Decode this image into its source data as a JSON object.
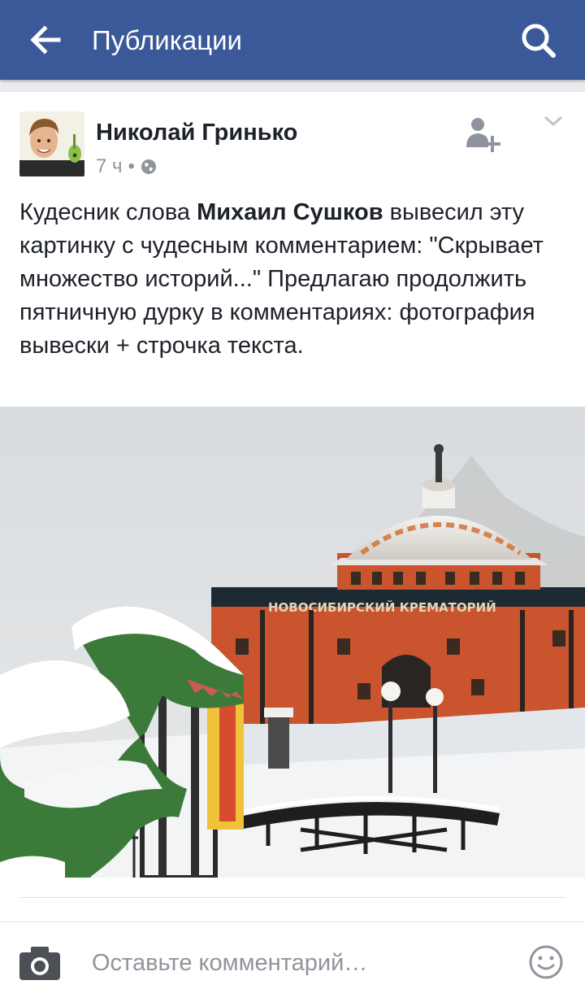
{
  "topbar": {
    "title": "Публикации",
    "back_icon": "arrow-left-icon",
    "search_icon": "search-icon",
    "background_color": "#3b5998"
  },
  "post": {
    "author": "Николай Гринько",
    "time": "7 ч",
    "separator": "•",
    "privacy_icon": "globe-icon",
    "add_friend_icon": "add-friend-icon",
    "menu_icon": "chevron-down-icon",
    "text": {
      "part1": "Кудесник слова ",
      "mention": "Михаил Сушков",
      "part2": " вывесил эту картинку с чудесным комментарием: \"Скрывает множество историй...\" Предлагаю продолжить пятничную дурку в комментариях: фотография вывески + строчка текста."
    },
    "photo": {
      "sign_text": "НОВОСИБИРСКИЙ КРЕМАТОРИЙ"
    }
  },
  "comment_bar": {
    "placeholder": "Оставьте комментарий…",
    "camera_icon": "camera-icon",
    "emoji_icon": "smiley-icon"
  }
}
